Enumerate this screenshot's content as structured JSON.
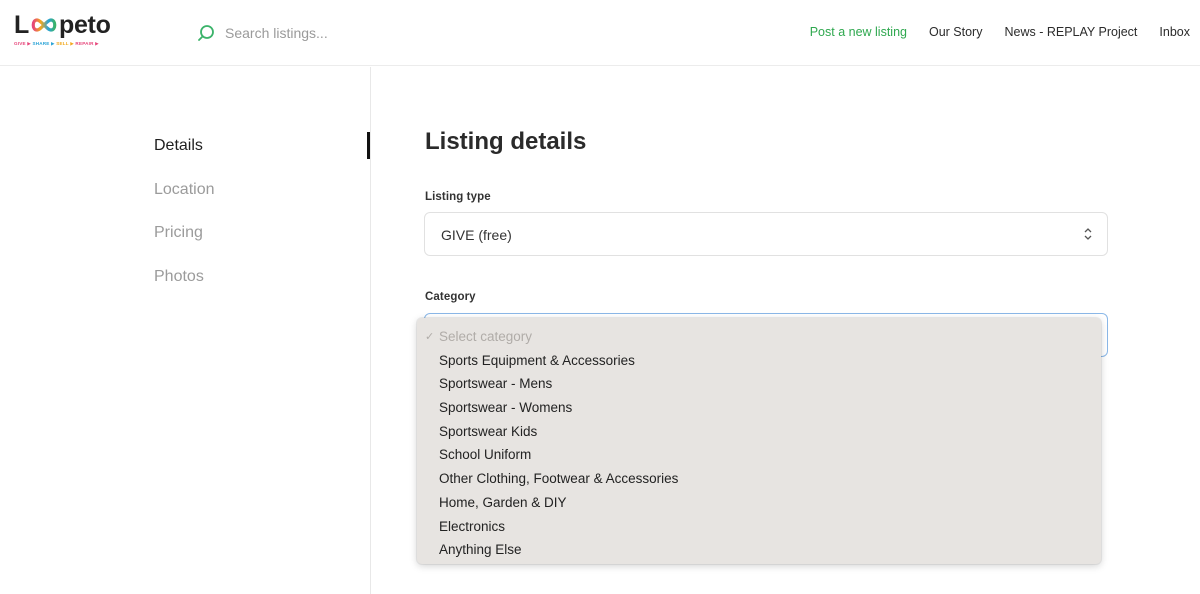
{
  "brand": {
    "name_prefix": "L",
    "name_suffix": "peto",
    "tagline": [
      "GIVE ▶",
      "SHARE ▶",
      "SELL ▶",
      "REPAIR ▶"
    ],
    "tagline_colors": [
      "#e6457a",
      "#2aa3d6",
      "#f2a81d",
      "#e6457a"
    ]
  },
  "search": {
    "placeholder": "Search listings...",
    "icon": "search-icon"
  },
  "nav": {
    "post_listing": "Post a new listing",
    "our_story": "Our Story",
    "news": "News - REPLAY Project",
    "inbox": "Inbox",
    "accent_color": "#2fa84f"
  },
  "side_nav": {
    "items": [
      {
        "label": "Details",
        "active": true
      },
      {
        "label": "Location",
        "active": false
      },
      {
        "label": "Pricing",
        "active": false
      },
      {
        "label": "Photos",
        "active": false
      }
    ]
  },
  "form": {
    "title": "Listing details",
    "listing_type": {
      "label": "Listing type",
      "value": "GIVE (free)"
    },
    "category": {
      "label": "Category",
      "options": [
        "Select category",
        "Sports Equipment & Accessories",
        "Sportswear - Mens",
        "Sportswear - Womens",
        "Sportswear Kids",
        "School Uniform",
        "Other Clothing, Footwear & Accessories",
        "Home, Garden & DIY",
        "Electronics",
        "Anything Else"
      ],
      "checkmark": "✓"
    }
  }
}
